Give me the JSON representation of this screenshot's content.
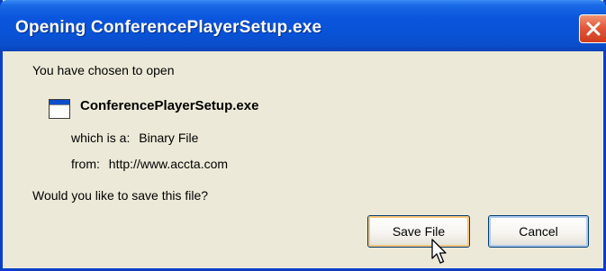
{
  "dialog": {
    "title": "Opening ConferencePlayerSetup.exe",
    "intro_text": "You have chosen to open",
    "file_name": "ConferencePlayerSetup.exe",
    "type_label": "which is a:",
    "type_value": "Binary File",
    "from_label": "from:",
    "from_value": "http://www.accta.com",
    "question": "Would you like to save this file?",
    "buttons": {
      "save_label": "Save File",
      "cancel_label": "Cancel"
    }
  },
  "icons": {
    "close": "close-icon",
    "file": "application-window-icon",
    "cursor": "mouse-pointer-icon"
  },
  "colors": {
    "titlebar": "#0853d6",
    "close_button": "#e2593a",
    "dialog_background": "#ece9d8",
    "default_button_focus": "#f4c47b"
  }
}
